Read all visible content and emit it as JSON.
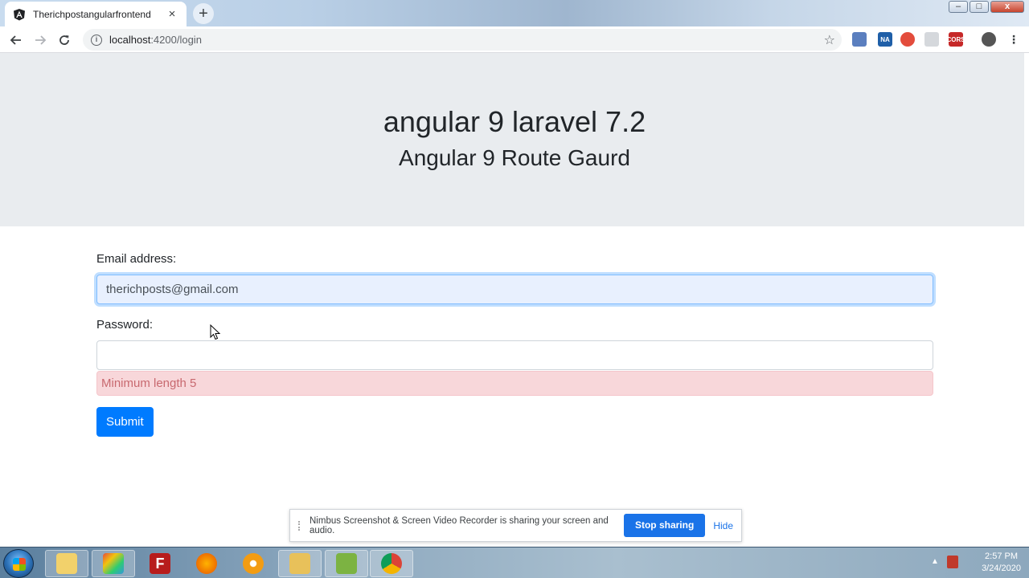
{
  "browser": {
    "tab_title": "Therichpostangularfrontend",
    "tab_close": "×",
    "new_tab": "+",
    "url_host": "localhost",
    "url_path": ":4200/login",
    "window_controls": {
      "minimize": "–",
      "maximize": "□",
      "close": "x"
    }
  },
  "page": {
    "title": "angular 9 laravel 7.2",
    "subtitle": "Angular 9 Route Gaurd"
  },
  "form": {
    "email_label": "Email address:",
    "email_value": "therichposts@gmail.com",
    "password_label": "Password:",
    "password_value": "",
    "error": "Minimum length 5",
    "submit_label": "Submit"
  },
  "sharebar": {
    "message": "Nimbus Screenshot & Screen Video Recorder is sharing your screen and audio.",
    "stop_label": "Stop sharing",
    "hide_label": "Hide"
  },
  "taskbar": {
    "time": "2:57 PM",
    "date": "3/24/2020"
  },
  "colors": {
    "primary": "#007bff",
    "jumbotron_bg": "#e9ecef",
    "alert_bg": "#f8d7da",
    "alert_text": "#c8696f"
  },
  "extensions": [
    "CORS",
    "NA"
  ]
}
